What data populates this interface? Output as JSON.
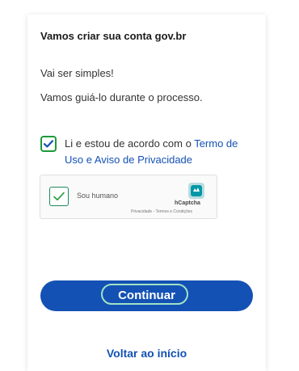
{
  "form": {
    "title": "Vamos criar sua conta gov.br",
    "line1": "Vai ser simples!",
    "line2": "Vamos guiá-lo durante o processo."
  },
  "consent": {
    "checked": true,
    "text_prefix": "Li e estou de acordo com o ",
    "link_text": "Termo de Uso e Aviso de Privacidade"
  },
  "captcha": {
    "label": "Sou humano",
    "brand": "hCaptcha",
    "links": "Privacidade - Termos e Condições",
    "checked": true
  },
  "buttons": {
    "continue": "Continuar",
    "back": "Voltar ao início"
  },
  "colors": {
    "primary": "#1351b4",
    "check_green": "#1c9a3a",
    "focus_ring": "#9fe2c7"
  }
}
